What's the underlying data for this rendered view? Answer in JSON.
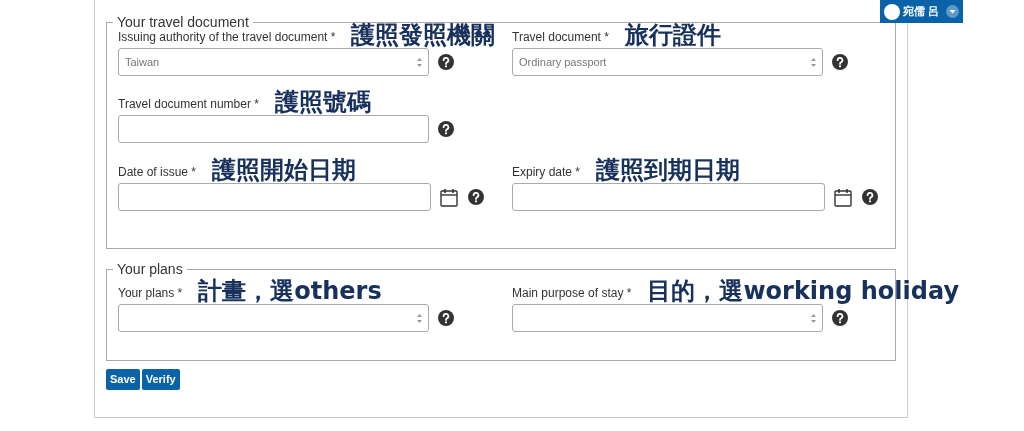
{
  "user_menu": {
    "name": "宛儒 呂"
  },
  "sections": [
    {
      "legend": "Your travel document",
      "rows": [
        [
          {
            "kind": "select",
            "label": "Issuing authority of the travel document *",
            "value": "Taiwan",
            "annotation": "護照發照機關"
          },
          {
            "kind": "select",
            "label": "Travel document *",
            "value": "Ordinary passport",
            "annotation": "旅行證件"
          }
        ],
        [
          {
            "kind": "text",
            "label": "Travel document number *",
            "annotation": "護照號碼"
          }
        ],
        [
          {
            "kind": "date",
            "label": "Date of issue *",
            "annotation": "護照開始日期"
          },
          {
            "kind": "date",
            "label": "Expiry date *",
            "annotation": "護照到期日期"
          }
        ]
      ]
    },
    {
      "legend": "Your plans",
      "rows": [
        [
          {
            "kind": "select",
            "label": "Your plans *",
            "annotation": "計畫，選others"
          },
          {
            "kind": "select",
            "label": "Main purpose of stay *",
            "annotation": "目的，選working holiday"
          }
        ]
      ]
    }
  ],
  "buttons": [
    {
      "label": "Save"
    },
    {
      "label": "Verify"
    }
  ]
}
